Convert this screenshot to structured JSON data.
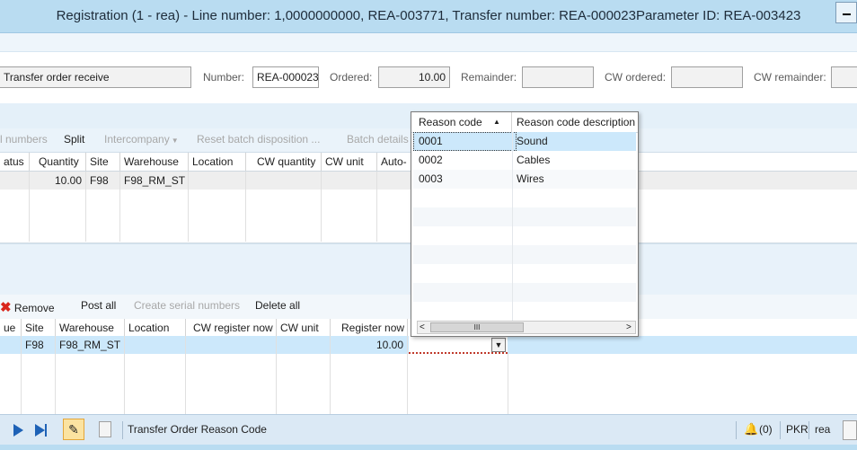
{
  "window": {
    "title": "Registration (1 - rea) - Line number: 1,0000000000, REA-003771, Transfer number: REA-000023Parameter ID: REA-003423"
  },
  "header": {
    "type_value": "Transfer order receive",
    "number_label": "Number:",
    "number_value": "REA-000023",
    "ordered_label": "Ordered:",
    "ordered_value": "10.00",
    "remainder_label": "Remainder:",
    "remainder_value": "",
    "cw_ordered_label": "CW ordered:",
    "cw_ordered_value": "",
    "cw_remainder_label": "CW remainder:",
    "cw_remainder_value": ""
  },
  "toolbar1": {
    "serial_numbers": "l numbers",
    "split": "Split",
    "intercompany": "Intercompany",
    "reset_batch": "Reset batch disposition ...",
    "batch_details": "Batch details"
  },
  "grid1": {
    "columns": [
      "atus",
      "Quantity",
      "Site",
      "Warehouse",
      "Location",
      "CW quantity",
      "CW unit",
      "Auto-"
    ],
    "rows": [
      [
        "",
        "10.00",
        "F98",
        "F98_RM_ST",
        "",
        "",
        "",
        ""
      ]
    ]
  },
  "toolbar2": {
    "remove": "Remove",
    "post_all": "Post all",
    "create_serial": "Create serial numbers",
    "delete_all": "Delete all"
  },
  "grid2": {
    "columns": [
      "ue",
      "Site",
      "Warehouse",
      "Location",
      "CW register now",
      "CW unit",
      "Register now"
    ],
    "rows": [
      [
        "",
        "F98",
        "F98_RM_ST",
        "",
        "",
        "",
        "10.00"
      ]
    ]
  },
  "reason_popup": {
    "columns": [
      "Reason code",
      "Reason code description"
    ],
    "rows": [
      {
        "code": "0001",
        "description": "Sound"
      },
      {
        "code": "0002",
        "description": "Cables"
      },
      {
        "code": "0003",
        "description": "Wires"
      }
    ],
    "scroll_left": "<",
    "scroll_thumb": "III",
    "scroll_right": ">"
  },
  "statusbar": {
    "text": "Transfer Order Reason Code",
    "notifications": "(0)",
    "currency": "PKR",
    "company": "rea"
  },
  "colors": {
    "title_bar": "#b9dcf1",
    "selected_row": "#cce8fb",
    "nav_arrow": "#1e62b6",
    "remove_icon": "#d9261c"
  }
}
